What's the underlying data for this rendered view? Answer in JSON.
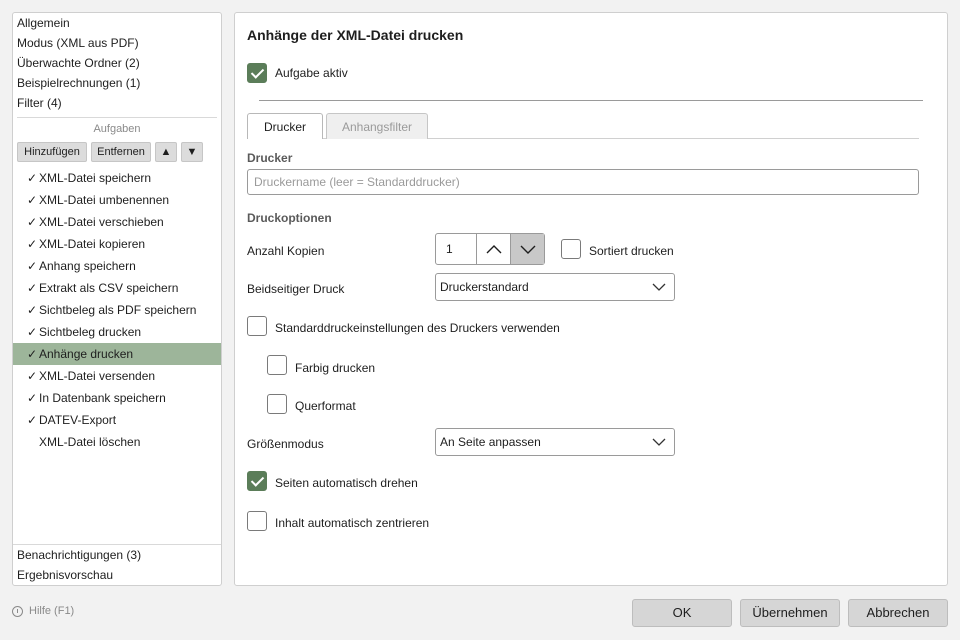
{
  "sidebar": {
    "top_items": [
      {
        "label": "Allgemein"
      },
      {
        "label": "Modus (XML aus PDF)"
      },
      {
        "label": "Überwachte Ordner (2)"
      },
      {
        "label": "Beispielrechnungen (1)"
      },
      {
        "label": "Filter (4)"
      }
    ],
    "tasks_title": "Aufgaben",
    "toolbar": {
      "add_label": "Hinzufügen",
      "remove_label": "Entfernen",
      "up_label": "▲",
      "down_label": "▼"
    },
    "tasks": [
      {
        "check": "✓",
        "label": "XML-Datei speichern"
      },
      {
        "check": "✓",
        "label": "XML-Datei umbenennen"
      },
      {
        "check": "✓",
        "label": "XML-Datei verschieben"
      },
      {
        "check": "✓",
        "label": "XML-Datei kopieren"
      },
      {
        "check": "✓",
        "label": "Anhang speichern"
      },
      {
        "check": "✓",
        "label": "Extrakt als CSV speichern"
      },
      {
        "check": "✓",
        "label": "Sichtbeleg als PDF speichern"
      },
      {
        "check": "✓",
        "label": "Sichtbeleg drucken"
      },
      {
        "check": "✓",
        "label": "Anhänge drucken"
      },
      {
        "check": "✓",
        "label": "XML-Datei versenden"
      },
      {
        "check": "✓",
        "label": "In Datenbank speichern"
      },
      {
        "check": "✓",
        "label": "DATEV-Export"
      },
      {
        "check": "",
        "label": "XML-Datei löschen"
      }
    ],
    "bottom_items": [
      {
        "label": "Benachrichtigungen (3)"
      },
      {
        "label": "Ergebnisvorschau"
      }
    ]
  },
  "main": {
    "title": "Anhänge der XML-Datei drucken",
    "task_active_label": "Aufgabe aktiv",
    "tabs": [
      {
        "label": "Drucker"
      },
      {
        "label": "Anhangsfilter"
      }
    ],
    "printer_section": "Drucker",
    "printer_placeholder": "Druckername (leer = Standarddrucker)",
    "options_section": "Druckoptionen",
    "copies_label": "Anzahl Kopien",
    "copies_value": "1",
    "collate_label": "Sortiert drucken",
    "duplex_label": "Beidseitiger Druck",
    "duplex_value": "Druckerstandard",
    "use_defaults_label": "Standarddruckeinstellungen des Druckers verwenden",
    "color_label": "Farbig drucken",
    "landscape_label": "Querformat",
    "size_mode_label": "Größenmodus",
    "size_mode_value": "An Seite anpassen",
    "auto_rotate_label": "Seiten automatisch drehen",
    "auto_center_label": "Inhalt automatisch zentrieren"
  },
  "footer": {
    "help_label": "Hilfe (F1)",
    "ok_label": "OK",
    "apply_label": "Übernehmen",
    "cancel_label": "Abbrechen"
  },
  "colors": {
    "accent": "#5b7d59",
    "selection": "#9db59a"
  }
}
